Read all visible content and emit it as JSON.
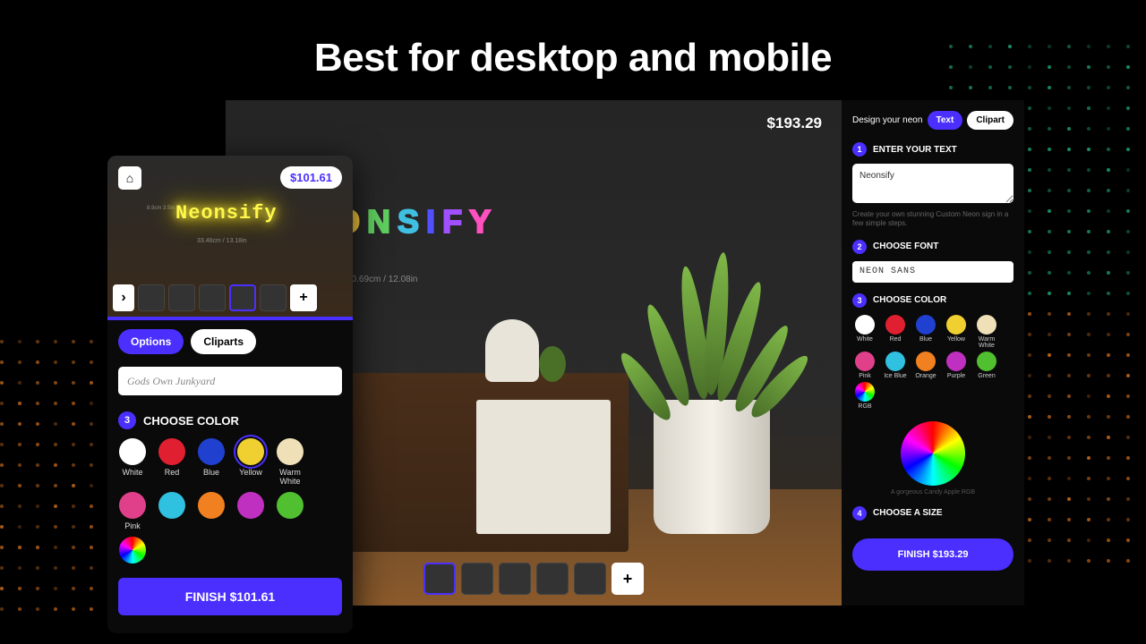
{
  "hero_title": "Best for desktop and mobile",
  "desktop": {
    "price": "$193.29",
    "neon_text": "NEONSIFY",
    "neon_colors": [
      "#ff4d4d",
      "#ff8040",
      "#ffd040",
      "#60d060",
      "#40c0e0",
      "#5050ff",
      "#a050ff",
      "#ff50c0"
    ],
    "dimensions": "30.69cm / 12.08in",
    "sidebar": {
      "title": "Design your neon",
      "tabs": {
        "text": "Text",
        "clipart": "Clipart",
        "active": "text"
      },
      "step1": {
        "num": "1",
        "label": "ENTER YOUR TEXT",
        "value": "Neonsify",
        "helper": "Create your own stunning Custom Neon sign in a few simple steps."
      },
      "step2": {
        "num": "2",
        "label": "CHOOSE FONT",
        "value": "NEON SANS"
      },
      "step3": {
        "num": "3",
        "label": "CHOOSE COLOR"
      },
      "colors": [
        {
          "name": "White",
          "hex": "#ffffff"
        },
        {
          "name": "Red",
          "hex": "#e02030"
        },
        {
          "name": "Blue",
          "hex": "#2040d0"
        },
        {
          "name": "Yellow",
          "hex": "#f0d030"
        },
        {
          "name": "Warm White",
          "hex": "#f0e0b8"
        },
        {
          "name": "Pink",
          "hex": "#e0408a"
        },
        {
          "name": "Ice Blue",
          "hex": "#30c0e0"
        },
        {
          "name": "Orange",
          "hex": "#f08020"
        },
        {
          "name": "Purple",
          "hex": "#c030c0"
        },
        {
          "name": "Green",
          "hex": "#50c030"
        },
        {
          "name": "RGB",
          "hex": "rgb"
        }
      ],
      "wheel_caption": "A gorgeous Candy Apple RGB",
      "step4": {
        "num": "4",
        "label": "CHOOSE A SIZE"
      },
      "finish": "FINISH $193.29"
    }
  },
  "mobile": {
    "price": "$101.61",
    "neon_text": "Neonsify",
    "dimensions_w": "33.46cm / 13.18in",
    "dimensions_h": "8.9cm 3.5in",
    "tabs": {
      "options": "Options",
      "cliparts": "Cliparts",
      "active": "options"
    },
    "text_input": "Gods Own Junkyard",
    "step3": {
      "num": "3",
      "label": "CHOOSE COLOR"
    },
    "colors": [
      {
        "name": "White",
        "hex": "#ffffff"
      },
      {
        "name": "Red",
        "hex": "#e02030"
      },
      {
        "name": "Blue",
        "hex": "#2040d0"
      },
      {
        "name": "Yellow",
        "hex": "#f0d030",
        "selected": true
      },
      {
        "name": "Warm White",
        "hex": "#f0e0b8"
      },
      {
        "name": "Pink",
        "hex": "#e0408a"
      },
      {
        "name": "",
        "hex": "#30c0e0"
      },
      {
        "name": "",
        "hex": "#f08020"
      },
      {
        "name": "",
        "hex": "#c030c0"
      },
      {
        "name": "",
        "hex": "#50c030"
      },
      {
        "name": "",
        "hex": "rgb"
      }
    ],
    "finish": "FINISH $101.61"
  }
}
